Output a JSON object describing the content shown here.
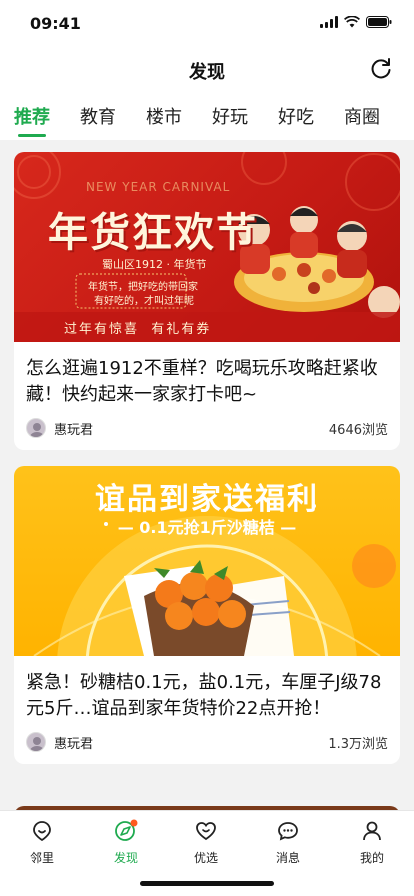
{
  "status": {
    "time": "09:41"
  },
  "nav": {
    "title": "发现"
  },
  "tabs": [
    {
      "label": "推荐",
      "active": true
    },
    {
      "label": "教育",
      "active": false
    },
    {
      "label": "楼市",
      "active": false
    },
    {
      "label": "好玩",
      "active": false
    },
    {
      "label": "好吃",
      "active": false
    },
    {
      "label": "商圈",
      "active": false
    }
  ],
  "cards": [
    {
      "banner": {
        "headline": "年货狂欢节",
        "english": "NEW YEAR CARNIVAL",
        "sub": "蜀山区1912 · 年货节",
        "note1": "年货节，把好吃的带回家",
        "note2": "有好吃的，才叫过年呢",
        "bottom": "过年有惊喜  有礼有券"
      },
      "title": "怎么逛遍1912不重样？吃喝玩乐攻略赶紧收藏！快约起来一家家打卡吧~",
      "author": "惠玩君",
      "views": "4646浏览"
    },
    {
      "banner": {
        "headline": "谊品到家送福利",
        "sub": "— 0.1元抢1斤沙糖桔 —"
      },
      "title": "紧急！砂糖桔0.1元，盐0.1元，车厘子J级78元5斤…谊品到家年货特价22点开抢！",
      "author": "惠玩君",
      "views": "1.3万浏览"
    }
  ],
  "tabbar": [
    {
      "label": "邻里",
      "icon": "neighborhood-icon",
      "active": false
    },
    {
      "label": "发现",
      "icon": "discover-icon",
      "active": true
    },
    {
      "label": "优选",
      "icon": "select-icon",
      "active": false
    },
    {
      "label": "消息",
      "icon": "message-icon",
      "active": false
    },
    {
      "label": "我的",
      "icon": "profile-icon",
      "active": false
    }
  ],
  "colors": {
    "accent": "#1faa4f",
    "banner_red": "#d7281c",
    "banner_yellow": "#ffb300"
  }
}
